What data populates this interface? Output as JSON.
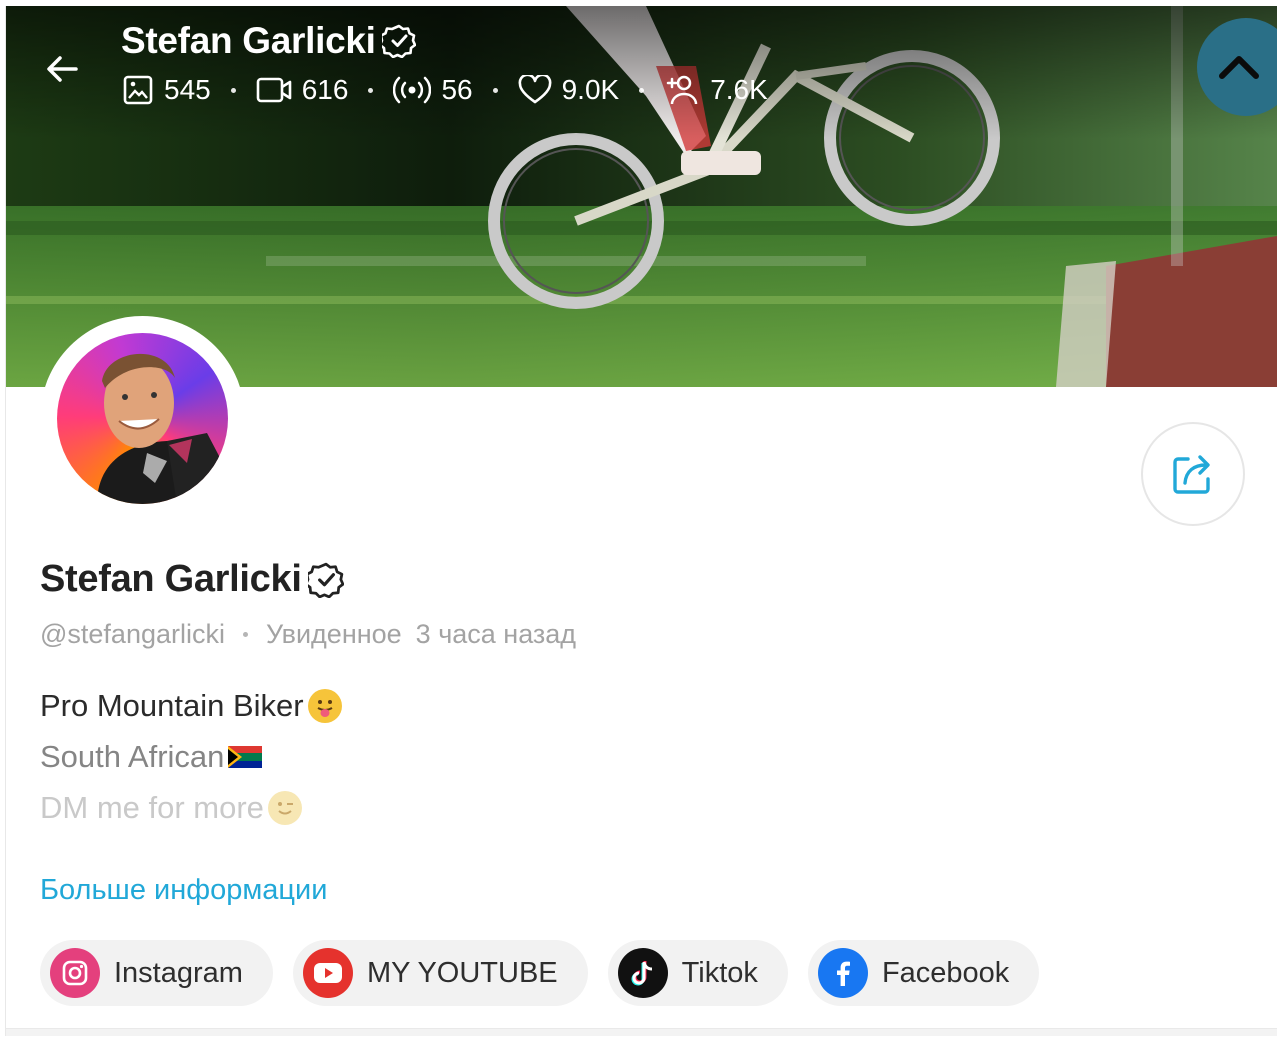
{
  "header": {
    "title": "Stefan Garlicki",
    "stats": [
      {
        "icon": "image-icon",
        "value": "545"
      },
      {
        "icon": "video-icon",
        "value": "616"
      },
      {
        "icon": "live-icon",
        "value": "56"
      },
      {
        "icon": "heart-icon",
        "value": "9.0K"
      },
      {
        "icon": "subscribers-icon",
        "value": "7.6K"
      }
    ]
  },
  "profile": {
    "name": "Stefan Garlicki",
    "handle": "@stefangarlicki",
    "seen_label": "Увиденное",
    "seen_time": "3 часа назад",
    "bio": [
      {
        "text": "Pro Mountain Biker",
        "emoji": "tongue-out-emoji"
      },
      {
        "text": "South African",
        "emoji": "south-africa-flag"
      },
      {
        "text": "DM me for more",
        "emoji": "wink-emoji"
      }
    ],
    "more_info": "Больше информации"
  },
  "links": [
    {
      "name": "instagram",
      "label": "Instagram",
      "color": "#e4407d"
    },
    {
      "name": "youtube",
      "label": "MY YOUTUBE",
      "color": "#ff0000"
    },
    {
      "name": "tiktok",
      "label": "Tiktok",
      "color": "#111111"
    },
    {
      "name": "facebook",
      "label": "Facebook",
      "color": "#1877f2"
    }
  ],
  "colors": {
    "accent": "#21a8d8",
    "verified": "#ffffff",
    "scroll_button": "#2a6f87"
  }
}
